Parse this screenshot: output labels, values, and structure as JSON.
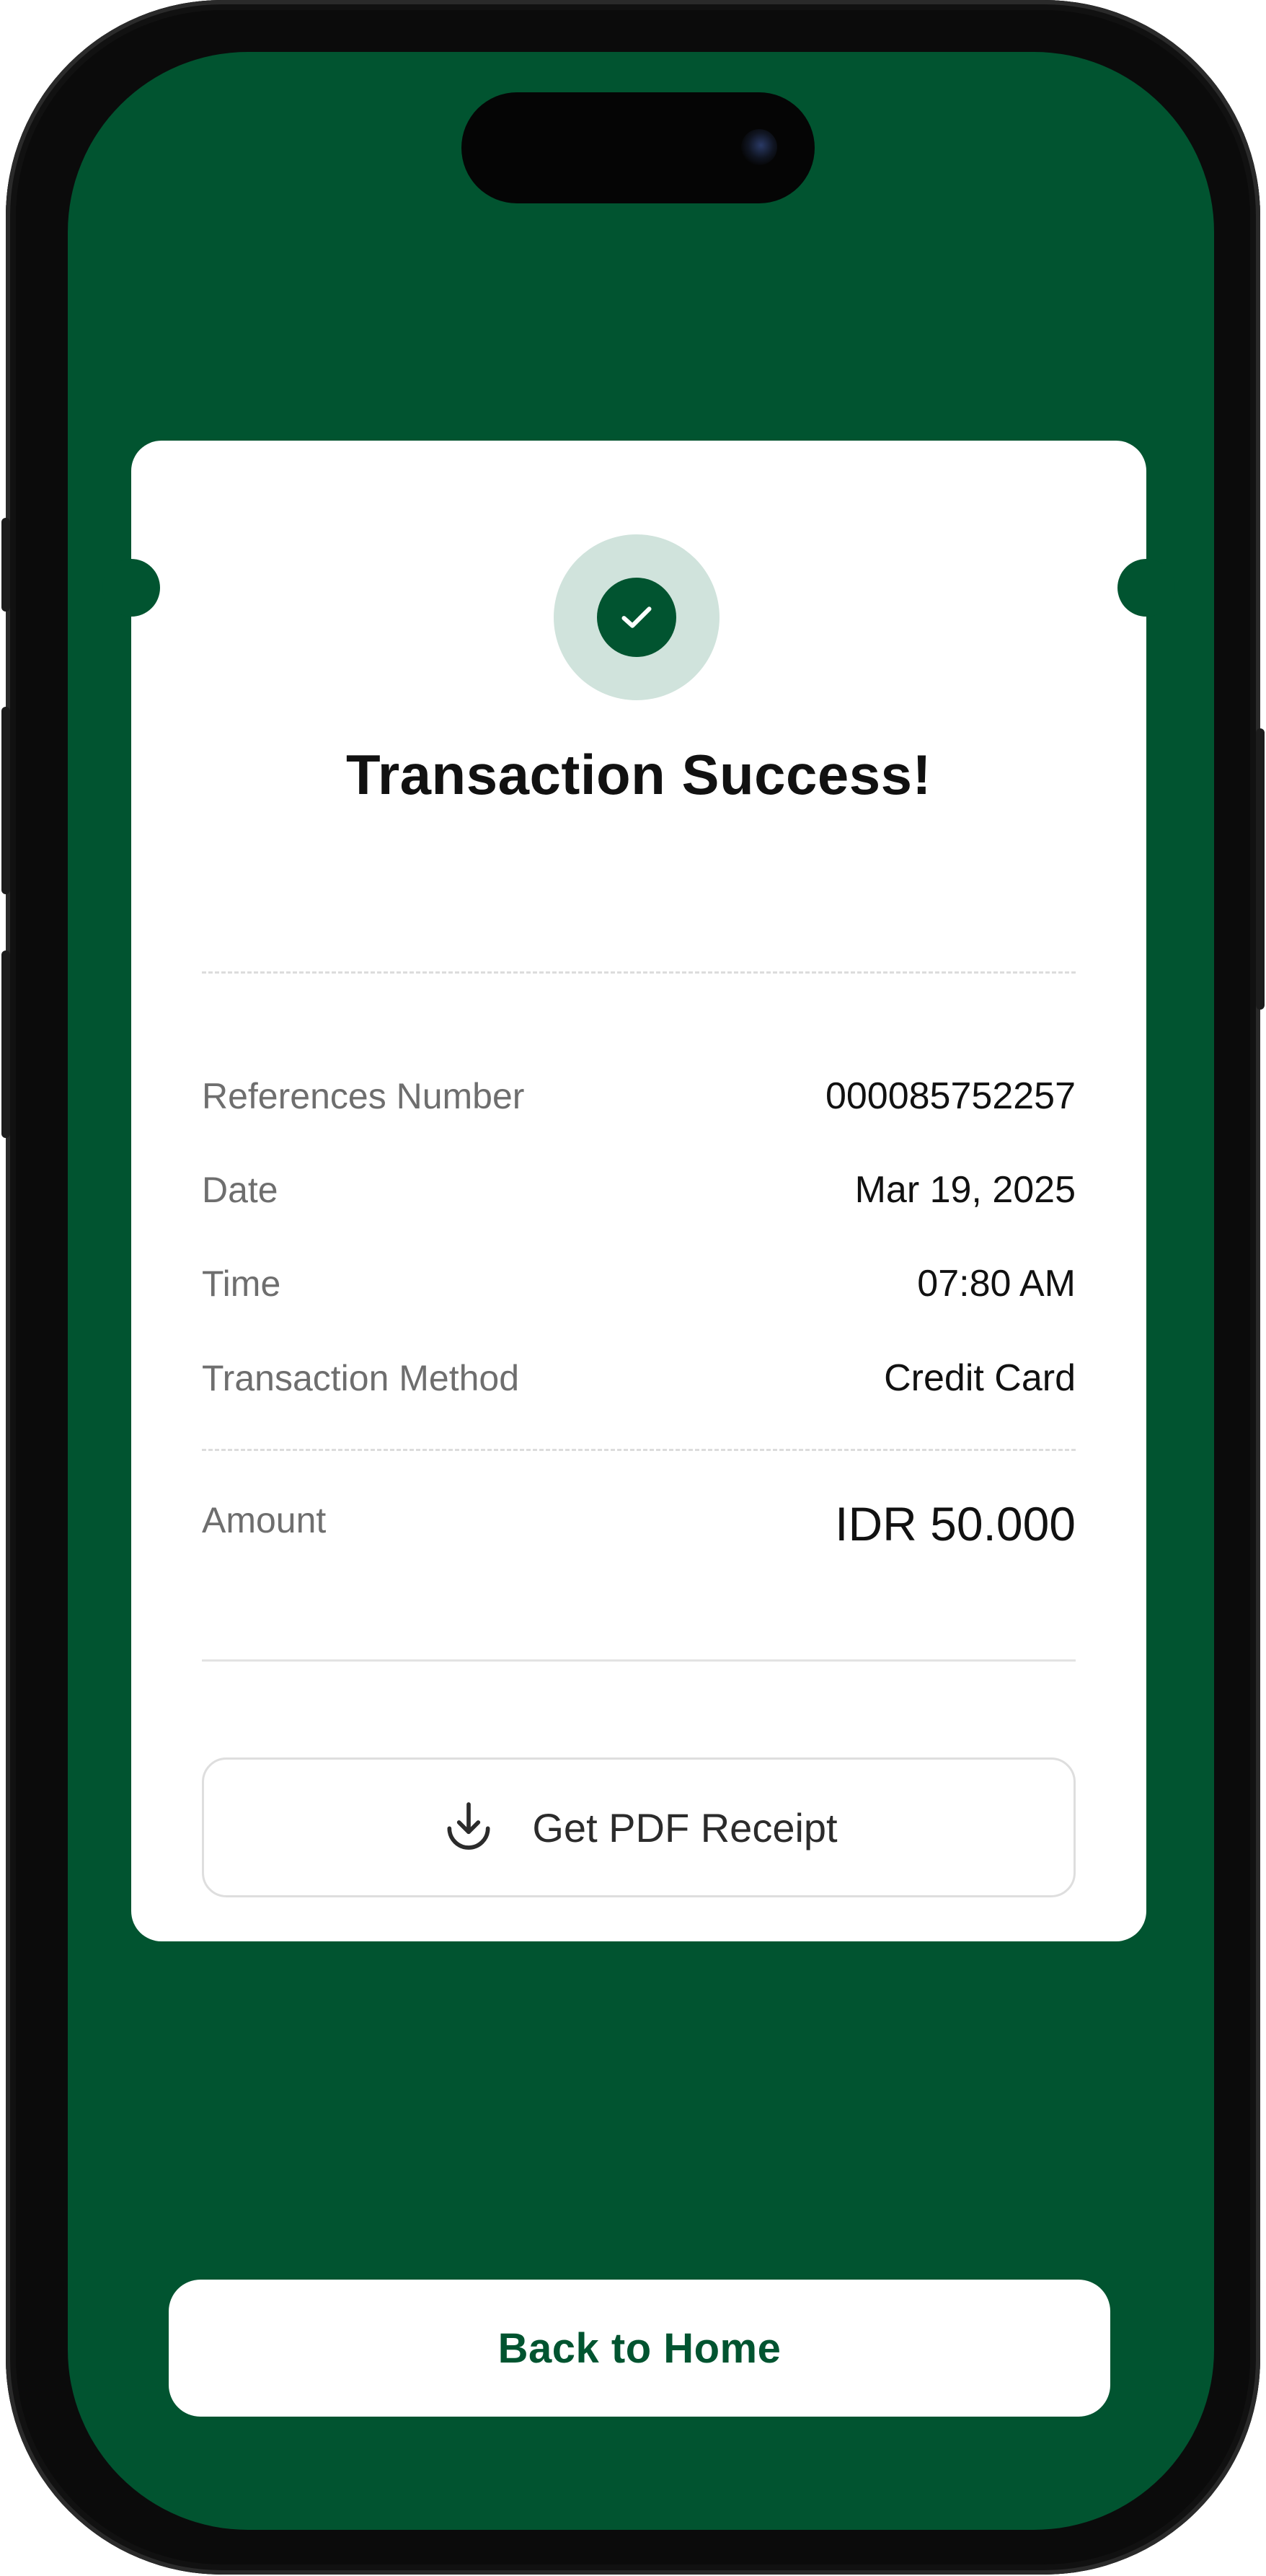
{
  "colors": {
    "brand": "#015430",
    "success_bg": "#d0e3dc",
    "card": "#ffffff",
    "label": "#6e6e6e",
    "value": "#111111"
  },
  "status": {
    "icon": "check-icon",
    "title": "Transaction Success!"
  },
  "details": [
    {
      "label": "References Number",
      "value": "000085752257"
    },
    {
      "label": "Date",
      "value": "Mar 19, 2025"
    },
    {
      "label": "Time",
      "value": "07:80 AM"
    },
    {
      "label": "Transaction Method",
      "value": "Credit Card"
    }
  ],
  "amount": {
    "label": "Amount",
    "value": "IDR 50.000"
  },
  "actions": {
    "pdf_icon": "download-icon",
    "pdf_label": "Get PDF Receipt",
    "home_label": "Back to Home"
  }
}
